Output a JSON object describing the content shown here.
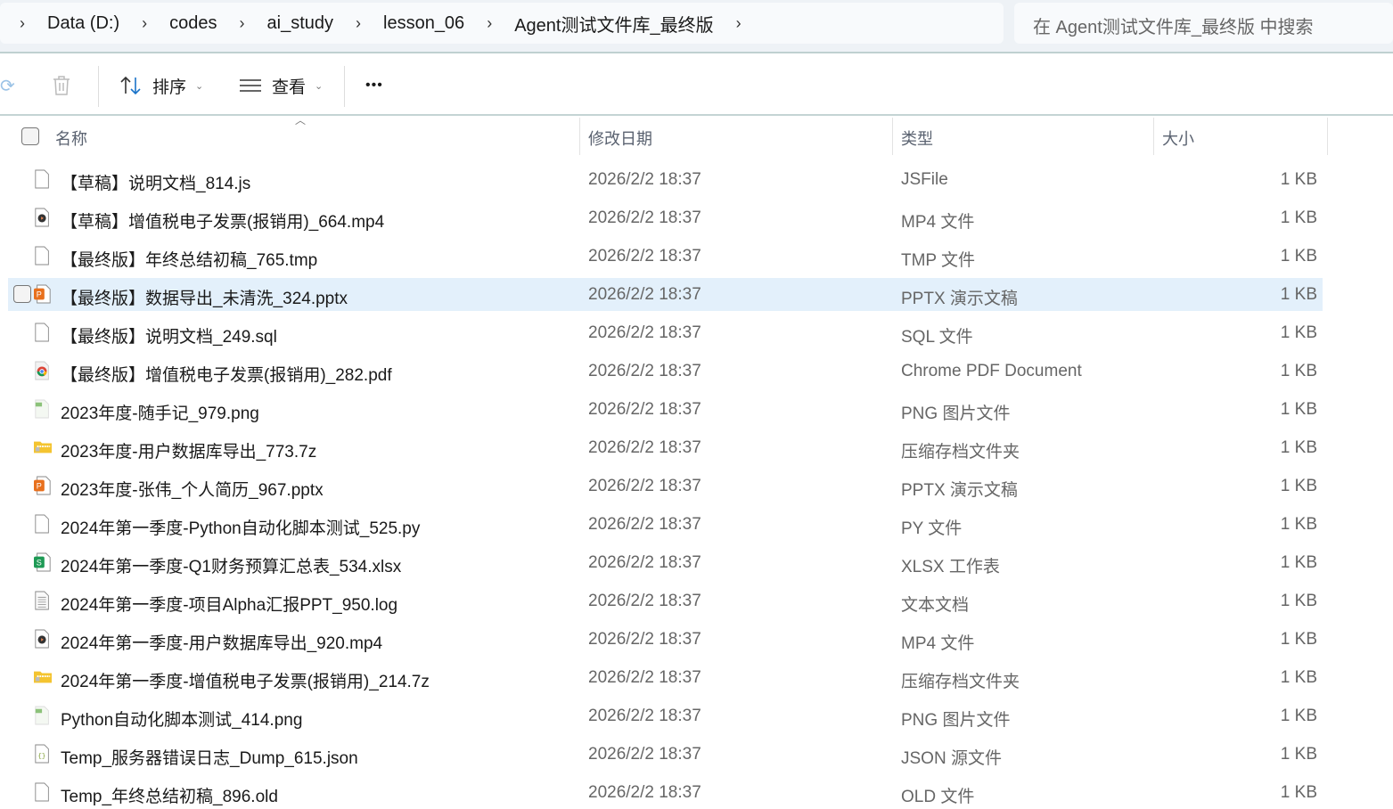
{
  "breadcrumb": [
    "Data (D:)",
    "codes",
    "ai_study",
    "lesson_06",
    "Agent测试文件库_最终版"
  ],
  "search": {
    "placeholder": "在 Agent测试文件库_最终版 中搜索"
  },
  "toolbar": {
    "sort": "排序",
    "view": "查看",
    "more": "•••"
  },
  "columns": {
    "name": "名称",
    "date": "修改日期",
    "type": "类型",
    "size": "大小"
  },
  "files": [
    {
      "name": "【草稿】说明文档_814.js",
      "date": "2026/2/2 18:37",
      "type": "JSFile",
      "size": "1 KB",
      "icon": "blank"
    },
    {
      "name": "【草稿】增值税电子发票(报销用)_664.mp4",
      "date": "2026/2/2 18:37",
      "type": "MP4 文件",
      "size": "1 KB",
      "icon": "video"
    },
    {
      "name": "【最终版】年终总结初稿_765.tmp",
      "date": "2026/2/2 18:37",
      "type": "TMP 文件",
      "size": "1 KB",
      "icon": "blank"
    },
    {
      "name": "【最终版】数据导出_未清洗_324.pptx",
      "date": "2026/2/2 18:37",
      "type": "PPTX 演示文稿",
      "size": "1 KB",
      "icon": "ppt",
      "selected": true
    },
    {
      "name": "【最终版】说明文档_249.sql",
      "date": "2026/2/2 18:37",
      "type": "SQL 文件",
      "size": "1 KB",
      "icon": "blank"
    },
    {
      "name": "【最终版】增值税电子发票(报销用)_282.pdf",
      "date": "2026/2/2 18:37",
      "type": "Chrome PDF Document",
      "size": "1 KB",
      "icon": "chrome"
    },
    {
      "name": "2023年度-随手记_979.png",
      "date": "2026/2/2 18:37",
      "type": "PNG 图片文件",
      "size": "1 KB",
      "icon": "png"
    },
    {
      "name": "2023年度-用户数据库导出_773.7z",
      "date": "2026/2/2 18:37",
      "type": "压缩存档文件夹",
      "size": "1 KB",
      "icon": "zip"
    },
    {
      "name": "2023年度-张伟_个人简历_967.pptx",
      "date": "2026/2/2 18:37",
      "type": "PPTX 演示文稿",
      "size": "1 KB",
      "icon": "ppt"
    },
    {
      "name": "2024年第一季度-Python自动化脚本测试_525.py",
      "date": "2026/2/2 18:37",
      "type": "PY 文件",
      "size": "1 KB",
      "icon": "blank"
    },
    {
      "name": "2024年第一季度-Q1财务预算汇总表_534.xlsx",
      "date": "2026/2/2 18:37",
      "type": "XLSX 工作表",
      "size": "1 KB",
      "icon": "xlsx"
    },
    {
      "name": "2024年第一季度-项目Alpha汇报PPT_950.log",
      "date": "2026/2/2 18:37",
      "type": "文本文档",
      "size": "1 KB",
      "icon": "text"
    },
    {
      "name": "2024年第一季度-用户数据库导出_920.mp4",
      "date": "2026/2/2 18:37",
      "type": "MP4 文件",
      "size": "1 KB",
      "icon": "video"
    },
    {
      "name": "2024年第一季度-增值税电子发票(报销用)_214.7z",
      "date": "2026/2/2 18:37",
      "type": "压缩存档文件夹",
      "size": "1 KB",
      "icon": "zip"
    },
    {
      "name": "Python自动化脚本测试_414.png",
      "date": "2026/2/2 18:37",
      "type": "PNG 图片文件",
      "size": "1 KB",
      "icon": "png"
    },
    {
      "name": "Temp_服务器错误日志_Dump_615.json",
      "date": "2026/2/2 18:37",
      "type": "JSON 源文件",
      "size": "1 KB",
      "icon": "json"
    },
    {
      "name": "Temp_年终总结初稿_896.old",
      "date": "2026/2/2 18:37",
      "type": "OLD 文件",
      "size": "1 KB",
      "icon": "blank"
    }
  ]
}
